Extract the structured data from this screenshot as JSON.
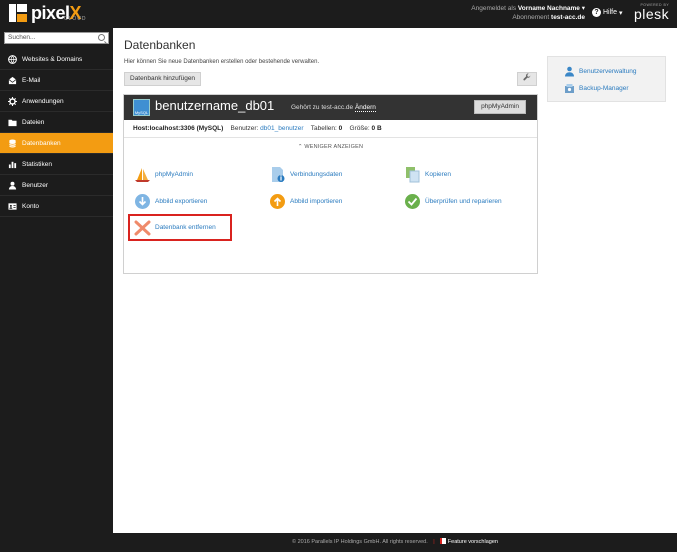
{
  "header": {
    "logo_text_main": "pixel",
    "logo_text_accent": "X",
    "logo_sub": "CLOUD",
    "logged_in_label": "Angemeldet als",
    "user_name": "Vorname Nachname",
    "subscription_label": "Abonnement",
    "subscription_value": "test-acc.de",
    "help_label": "Hilfe",
    "powered_by": "POWERED BY",
    "plesk_label": "plesk"
  },
  "sidebar": {
    "search_placeholder": "Suchen...",
    "items": [
      {
        "label": "Websites & Domains",
        "icon": "globe-icon"
      },
      {
        "label": "E-Mail",
        "icon": "mail-icon"
      },
      {
        "label": "Anwendungen",
        "icon": "gear-icon"
      },
      {
        "label": "Dateien",
        "icon": "folder-icon"
      },
      {
        "label": "Datenbanken",
        "icon": "database-icon",
        "active": true
      },
      {
        "label": "Statistiken",
        "icon": "bar-chart-icon"
      },
      {
        "label": "Benutzer",
        "icon": "user-icon"
      },
      {
        "label": "Konto",
        "icon": "account-card-icon"
      }
    ]
  },
  "main": {
    "title": "Datenbanken",
    "description": "Hier können Sie neue Datenbanken erstellen oder bestehende verwalten.",
    "add_button": "Datenbank hinzufügen",
    "database": {
      "name": "benutzername_db01",
      "owner_label": "Gehört zu test-acc.de",
      "change_link": "Ändern",
      "phpmyadmin_button": "phpMyAdmin",
      "host_label": "Host:",
      "host_value": "localhost:3306 (MySQL)",
      "users_label": "Benutzer:",
      "users_value": "db01_benutzer",
      "tables_label": "Tabellen:",
      "tables_value": "0",
      "size_label": "Größe:",
      "size_value": "0 B",
      "less_label": "WENIGER ANZEIGEN",
      "actions": [
        {
          "label": "phpMyAdmin",
          "icon": "phpmyadmin-sail-icon"
        },
        {
          "label": "Verbindungsdaten",
          "icon": "connection-info-icon"
        },
        {
          "label": "Kopieren",
          "icon": "copy-icon"
        },
        {
          "label": "Abbild exportieren",
          "icon": "export-icon"
        },
        {
          "label": "Abbild importieren",
          "icon": "import-icon"
        },
        {
          "label": "Überprüfen und reparieren",
          "icon": "check-icon"
        },
        {
          "label": "Datenbank entfernen",
          "icon": "remove-x-icon"
        }
      ]
    }
  },
  "side_panel": {
    "items": [
      {
        "label": "Benutzerverwaltung",
        "icon": "user-management-icon"
      },
      {
        "label": "Backup-Manager",
        "icon": "backup-icon"
      }
    ]
  },
  "footer": {
    "copyright": "© 2016 Parallels IP Holdings GmbH. All rights reserved.",
    "suggest": "Feature vorschlagen"
  },
  "colors": {
    "accent": "#f39c12",
    "dark": "#1c1c1c",
    "link": "#2a7bbf",
    "highlight": "#d9231f"
  }
}
